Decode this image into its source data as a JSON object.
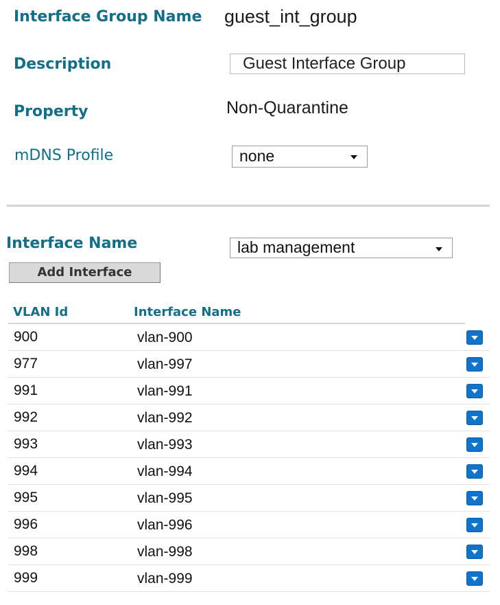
{
  "form": {
    "group_name_label": "Interface Group Name",
    "group_name_value": "guest_int_group",
    "description_label": "Description",
    "description_value": "Guest Interface Group",
    "property_label": "Property",
    "property_value": "Non-Quarantine",
    "mdns_label": "mDNS Profile",
    "mdns_selected": "none"
  },
  "add": {
    "interface_label": "Interface Name",
    "interface_selected": "lab management",
    "add_button": "Add Interface"
  },
  "table": {
    "headers": [
      "VLAN Id",
      "Interface Name"
    ],
    "rows": [
      {
        "vlan": "900",
        "name": "vlan-900"
      },
      {
        "vlan": "977",
        "name": "vlan-997"
      },
      {
        "vlan": "991",
        "name": "vlan-991"
      },
      {
        "vlan": "992",
        "name": "vlan-992"
      },
      {
        "vlan": "993",
        "name": "vlan-993"
      },
      {
        "vlan": "994",
        "name": "vlan-994"
      },
      {
        "vlan": "995",
        "name": "vlan-995"
      },
      {
        "vlan": "996",
        "name": "vlan-996"
      },
      {
        "vlan": "998",
        "name": "vlan-998"
      },
      {
        "vlan": "999",
        "name": "vlan-999"
      }
    ]
  },
  "icons": {
    "row_action": "dropdown-arrow-icon"
  },
  "colors": {
    "label": "#136f87",
    "action_button": "#1173c9"
  }
}
